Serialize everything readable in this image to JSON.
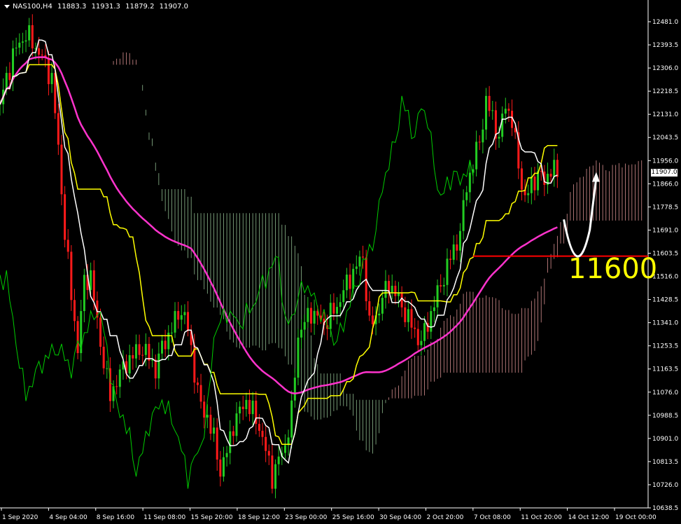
{
  "header": {
    "symbol": "NAS100,H4",
    "open": "11883.3",
    "high": "11931.3",
    "low": "11879.2",
    "close": "11907.0"
  },
  "current_price_label": "11907.0",
  "annotation": {
    "text": "11600",
    "color": "#ffff00"
  },
  "colors": {
    "background": "#000000",
    "bull_candle": "#22cc22",
    "bear_candle": "#ff1a1a",
    "tenkan": "#ffffff",
    "kijun": "#ffff00",
    "chikou": "#00cc00",
    "ma": "#ff33cc",
    "cloud_bull": "#ffaaaa",
    "cloud_bear": "#aaddaa",
    "level_line": "#ff0000",
    "arrow": "#ffffff"
  },
  "chart_data": {
    "type": "candlestick",
    "instrument": "NAS100",
    "timeframe": "H4",
    "ylim": [
      10638.3,
      12530
    ],
    "y_ticks": [
      "12481.0",
      "12393.5",
      "12306.0",
      "12218.5",
      "12131.0",
      "12043.5",
      "11956.0",
      "11866.0",
      "11778.5",
      "11691.0",
      "11603.5",
      "11516.0",
      "11428.5",
      "11341.0",
      "11253.5",
      "11163.5",
      "11076.0",
      "10988.5",
      "10901.0",
      "10813.5",
      "10726.0",
      "10638.5"
    ],
    "x_ticks": [
      "1 Sep 2020",
      "4 Sep 04:00",
      "8 Sep 16:00",
      "11 Sep 08:00",
      "15 Sep 20:00",
      "18 Sep 12:00",
      "23 Sep 00:00",
      "25 Sep 16:00",
      "30 Sep 04:00",
      "2 Oct 20:00",
      "7 Oct 08:00",
      "11 Oct 20:00",
      "14 Oct 12:00",
      "19 Oct 00:00"
    ],
    "price_path": [
      [
        0,
        12180
      ],
      [
        2,
        12370
      ],
      [
        4,
        12450
      ],
      [
        6,
        12380
      ],
      [
        8,
        12280
      ],
      [
        9,
        12010
      ],
      [
        10,
        11690
      ],
      [
        11,
        11450
      ],
      [
        12,
        11250
      ],
      [
        13,
        11500
      ],
      [
        14,
        11530
      ],
      [
        15,
        11340
      ],
      [
        16,
        11200
      ],
      [
        17,
        11060
      ],
      [
        18,
        11130
      ],
      [
        20,
        11210
      ],
      [
        22,
        11250
      ],
      [
        24,
        11170
      ],
      [
        25,
        11250
      ],
      [
        27,
        11350
      ],
      [
        28,
        11400
      ],
      [
        29,
        11320
      ],
      [
        30,
        11160
      ],
      [
        31,
        11020
      ],
      [
        32,
        10990
      ],
      [
        33,
        10900
      ],
      [
        34,
        10780
      ],
      [
        35,
        10850
      ],
      [
        36,
        10960
      ],
      [
        38,
        11050
      ],
      [
        40,
        10950
      ],
      [
        42,
        10760
      ],
      [
        44,
        10880
      ],
      [
        45,
        11000
      ],
      [
        46,
        11300
      ],
      [
        48,
        11390
      ],
      [
        50,
        11340
      ],
      [
        52,
        11410
      ],
      [
        54,
        11520
      ],
      [
        56,
        11600
      ],
      [
        57,
        11330
      ],
      [
        58,
        11370
      ],
      [
        60,
        11500
      ],
      [
        62,
        11410
      ],
      [
        64,
        11310
      ],
      [
        65,
        11270
      ],
      [
        67,
        11420
      ],
      [
        69,
        11560
      ],
      [
        71,
        11690
      ],
      [
        72,
        11870
      ],
      [
        74,
        12040
      ],
      [
        75,
        12190
      ],
      [
        76,
        12130
      ],
      [
        77,
        12050
      ],
      [
        78,
        12180
      ],
      [
        79,
        12120
      ],
      [
        80,
        11940
      ],
      [
        81,
        11820
      ],
      [
        82,
        11870
      ],
      [
        83,
        11920
      ],
      [
        84,
        11880
      ],
      [
        85,
        11940
      ],
      [
        86,
        11907
      ]
    ],
    "grid": false,
    "legend": "none",
    "horizontal_level": 11600,
    "forecast_path": [
      [
        87,
        11740
      ],
      [
        89,
        11640
      ],
      [
        91,
        11700
      ],
      [
        92,
        11900
      ]
    ]
  }
}
